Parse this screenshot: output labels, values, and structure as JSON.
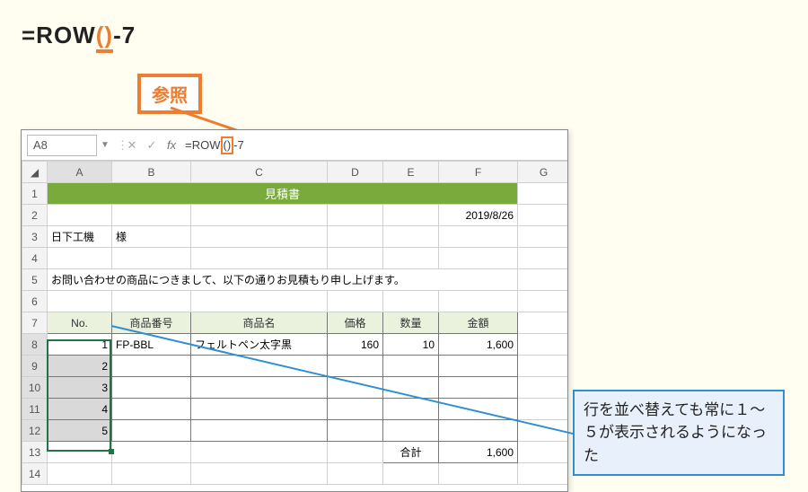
{
  "formula_display": {
    "prefix": "=ROW",
    "paren": "()",
    "suffix": "-7"
  },
  "callout_label": "参照",
  "annotation": "行を並べ替えても常に１～５が表示されるようになった",
  "namebox": "A8",
  "formula_bar": {
    "prefix": "=ROW",
    "paren": "()",
    "suffix": "-7"
  },
  "cols": [
    "A",
    "B",
    "C",
    "D",
    "E",
    "F",
    "G"
  ],
  "rows": [
    {
      "n": 1,
      "merged_title": "見積書"
    },
    {
      "n": 2,
      "f": "2019/8/26"
    },
    {
      "n": 3,
      "a": "日下工機",
      "b": "様"
    },
    {
      "n": 4
    },
    {
      "n": 5,
      "text": "お問い合わせの商品につきまして、以下の通りお見積もり申し上げます。"
    },
    {
      "n": 6
    },
    {
      "n": 7,
      "head": [
        "No.",
        "商品番号",
        "商品名",
        "価格",
        "数量",
        "金額"
      ]
    },
    {
      "n": 8,
      "a": "1",
      "b": "FP-BBL",
      "c": "フェルトペン太字黒",
      "d": "160",
      "e": "10",
      "f": "1,600"
    },
    {
      "n": 9,
      "a": "2"
    },
    {
      "n": 10,
      "a": "3"
    },
    {
      "n": 11,
      "a": "4"
    },
    {
      "n": 12,
      "a": "5"
    },
    {
      "n": 13,
      "e": "合計",
      "f": "1,600"
    },
    {
      "n": 14
    }
  ],
  "chart_data": {
    "type": "table",
    "title": "見積書",
    "date": "2019/8/26",
    "customer": "日下工機 様",
    "note": "お問い合わせの商品につきまして、以下の通りお見積もり申し上げます。",
    "columns": [
      "No.",
      "商品番号",
      "商品名",
      "価格",
      "数量",
      "金額"
    ],
    "rows": [
      {
        "No.": 1,
        "商品番号": "FP-BBL",
        "商品名": "フェルトペン太字黒",
        "価格": 160,
        "数量": 10,
        "金額": 1600
      },
      {
        "No.": 2
      },
      {
        "No.": 3
      },
      {
        "No.": 4
      },
      {
        "No.": 5
      }
    ],
    "total_label": "合計",
    "total": 1600,
    "formula": "=ROW()-7"
  }
}
